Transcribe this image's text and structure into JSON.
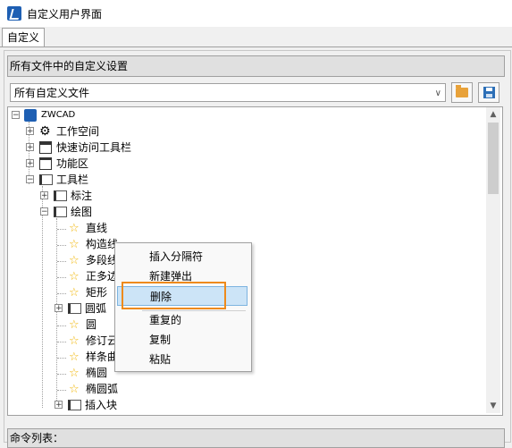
{
  "window": {
    "title": "自定义用户界面"
  },
  "tabs": [
    {
      "label": "自定义"
    }
  ],
  "group": {
    "header": "所有文件中的自定义设置"
  },
  "file_combo": {
    "value": "所有自定义文件"
  },
  "tree": {
    "root": "ZWCAD",
    "items": {
      "workspace": "工作空间",
      "quick_access": "快速访问工具栏",
      "ribbon": "功能区",
      "toolbars": "工具栏",
      "dimension": "标注",
      "draw": "绘图",
      "line": "直线",
      "construction_line": "构造线",
      "polyline": "多段线",
      "polygon": "正多边",
      "rectangle": "矩形",
      "arc": "圆弧",
      "circle": "圆",
      "revcloud": "修订云",
      "spline": "样条曲",
      "ellipse": "椭圆",
      "ellipse_arc": "椭圆弧",
      "insert_block": "插入块"
    }
  },
  "context_menu": {
    "insert_separator": "插入分隔符",
    "new_flyout": "新建弹出",
    "delete": "删除",
    "duplicate": "重复的",
    "copy": "复制",
    "paste": "粘贴"
  },
  "command_list": {
    "header": "命令列表："
  }
}
